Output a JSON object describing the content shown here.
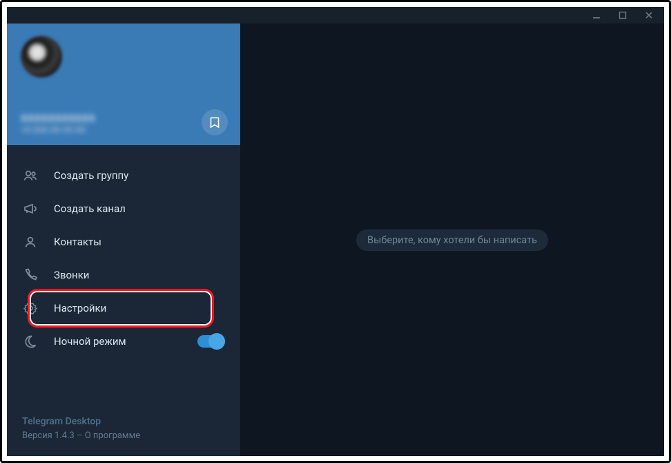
{
  "titlebar": {
    "minimize": "minimize",
    "maximize": "maximize",
    "close": "close"
  },
  "profile": {
    "username_masked": "XXXXXXXXXXX",
    "phone_masked": "+X XXX XX XX XX",
    "bookmark_name": "saved-messages"
  },
  "menu": {
    "items": [
      {
        "icon": "group-icon",
        "label": "Создать группу"
      },
      {
        "icon": "channel-icon",
        "label": "Создать канал"
      },
      {
        "icon": "contacts-icon",
        "label": "Контакты"
      },
      {
        "icon": "calls-icon",
        "label": "Звонки"
      },
      {
        "icon": "settings-icon",
        "label": "Настройки"
      },
      {
        "icon": "night-icon",
        "label": "Ночной режим",
        "toggle": true
      }
    ]
  },
  "footer": {
    "app_name": "Telegram Desktop",
    "version_prefix": "Версия 1.4.3",
    "sep": " – ",
    "about": "О программе"
  },
  "main": {
    "placeholder": "Выберите, кому хотели бы написать"
  }
}
